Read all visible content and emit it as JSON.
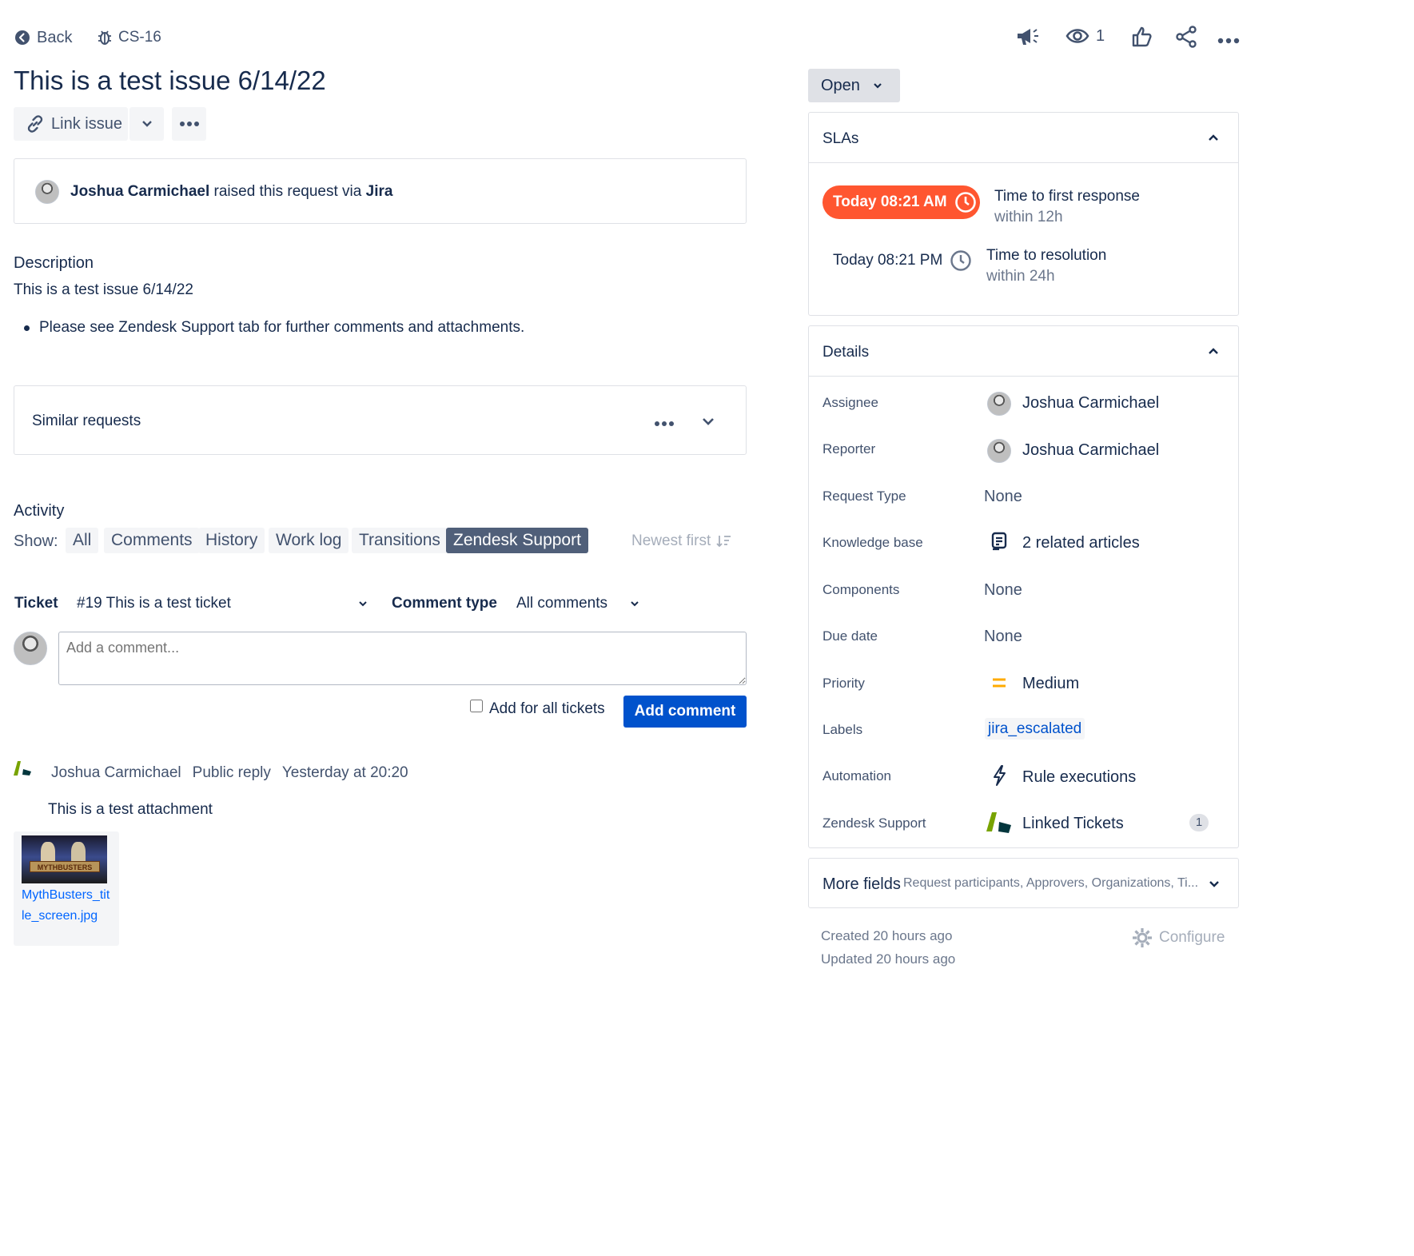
{
  "nav": {
    "back_label": "Back",
    "issue_key": "CS-16",
    "watchers_count": "1"
  },
  "issue": {
    "title": "This is a test issue 6/14/22"
  },
  "toolbar": {
    "link_issue_label": "Link issue"
  },
  "raised": {
    "user": "Joshua Carmichael",
    "text": "raised this request via",
    "channel": "Jira"
  },
  "description": {
    "heading": "Description",
    "text": "This is a test issue 6/14/22",
    "bullets": [
      "Please see Zendesk Support tab for further comments and attachments."
    ]
  },
  "similar": {
    "heading": "Similar requests"
  },
  "activity": {
    "heading": "Activity",
    "show_label": "Show:",
    "tabs": [
      "All",
      "Comments",
      "History",
      "Work log",
      "Transitions",
      "Zendesk Support"
    ],
    "active_tab": "Zendesk Support",
    "sort_label": "Newest first"
  },
  "zendesk": {
    "ticket_label": "Ticket",
    "ticket_value": "#19 This is a test ticket",
    "comment_type_label": "Comment type",
    "comment_type_value": "All comments",
    "comment_placeholder": "Add a comment...",
    "add_all_label": "Add for all tickets",
    "add_comment_button": "Add comment",
    "comment": {
      "author": "Joshua Carmichael",
      "kind": "Public reply",
      "time": "Yesterday at 20:20",
      "body": "This is a test attachment",
      "attachment_name_line1": "MythBusters_tit",
      "attachment_name_line2": "le_screen.jpg",
      "thumbnail_text": "MYTHBUSTERS"
    }
  },
  "status": {
    "label": "Open"
  },
  "slas": {
    "heading": "SLAs",
    "items": [
      {
        "time": "Today 08:21 AM",
        "name": "Time to first response",
        "sub": "within 12h",
        "breached": true
      },
      {
        "time": "Today 08:21 PM",
        "name": "Time to resolution",
        "sub": "within 24h",
        "breached": false
      }
    ]
  },
  "details": {
    "heading": "Details",
    "rows": [
      {
        "label": "Assignee",
        "value": "Joshua Carmichael"
      },
      {
        "label": "Reporter",
        "value": "Joshua Carmichael"
      },
      {
        "label": "Request Type",
        "value": "None"
      },
      {
        "label": "Knowledge base",
        "value": "2 related articles"
      },
      {
        "label": "Components",
        "value": "None"
      },
      {
        "label": "Due date",
        "value": "None"
      },
      {
        "label": "Priority",
        "value": "Medium"
      },
      {
        "label": "Labels",
        "value": "jira_escalated"
      },
      {
        "label": "Automation",
        "value": "Rule executions"
      },
      {
        "label": "Zendesk Support",
        "value": "Linked Tickets",
        "badge": "1"
      }
    ]
  },
  "more_fields": {
    "label": "More fields",
    "summary": "Request participants, Approvers, Organizations, Ti..."
  },
  "meta": {
    "created": "Created 20 hours ago",
    "updated": "Updated 20 hours ago",
    "configure_label": "Configure"
  },
  "colors": {
    "accent": "#0052cc",
    "sla_breached": "#ff5630",
    "status_bg": "#dfe1e6",
    "priority_medium": "#ffab00",
    "zendesk_green": "#78a300",
    "zendesk_dark": "#03363d"
  }
}
